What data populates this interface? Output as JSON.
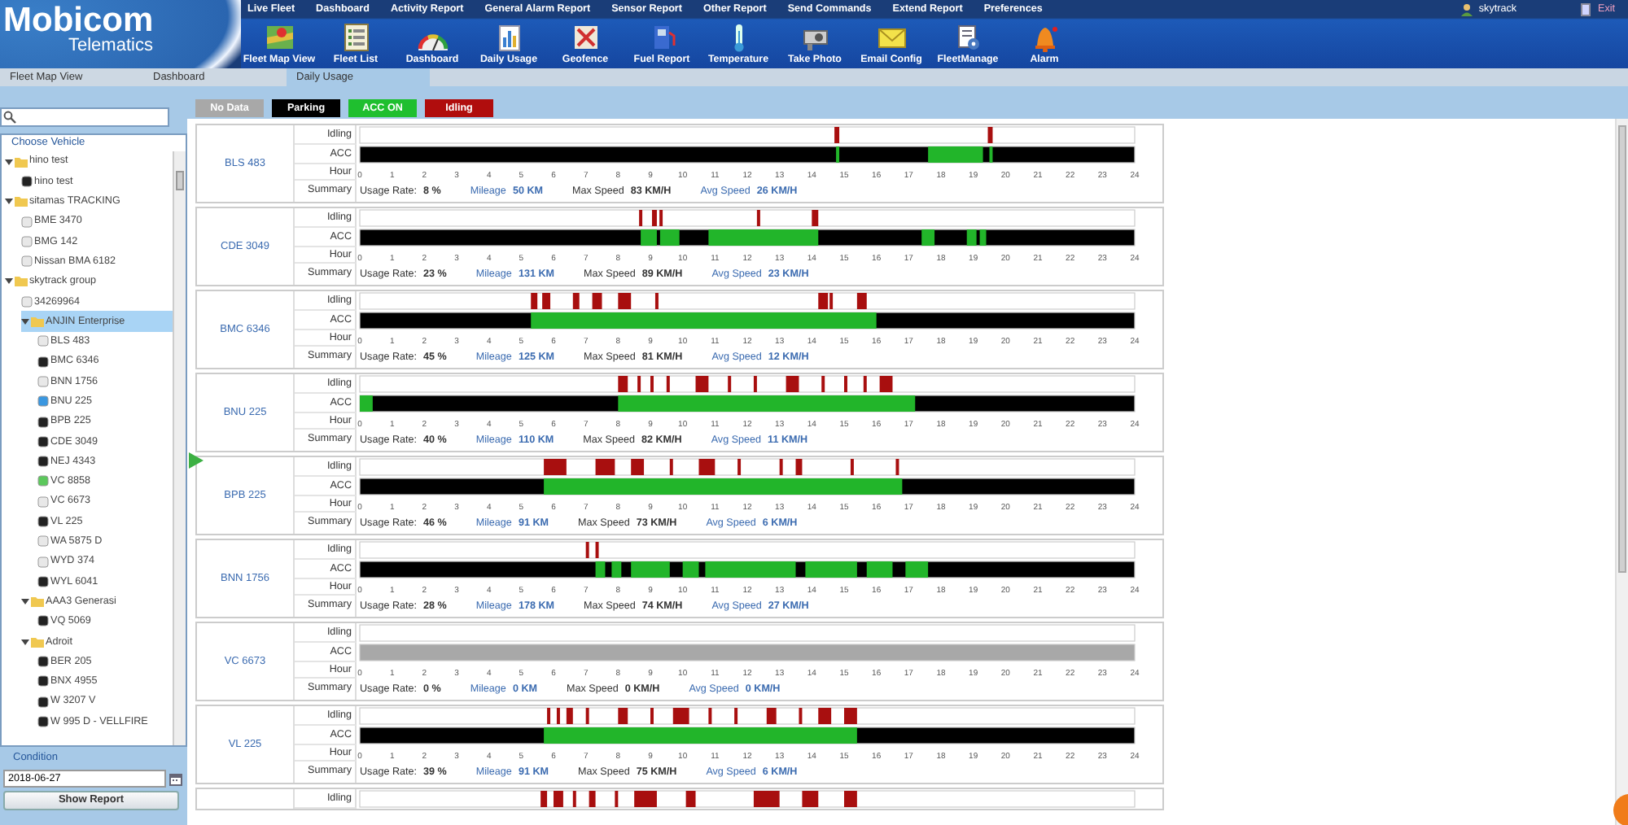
{
  "logo": {
    "name": "Mobicom",
    "subtitle": "Telematics"
  },
  "menu": [
    "Live Fleet",
    "Dashboard",
    "Activity Report",
    "General Alarm Report",
    "Sensor Report",
    "Other Report",
    "Send Commands",
    "Extend Report",
    "Preferences"
  ],
  "user": {
    "name": "skytrack",
    "exit": "Exit"
  },
  "toolbar": [
    {
      "label": "Fleet Map View"
    },
    {
      "label": "Fleet List"
    },
    {
      "label": "Dashboard"
    },
    {
      "label": "Daily Usage"
    },
    {
      "label": "Geofence"
    },
    {
      "label": "Fuel Report"
    },
    {
      "label": "Temperature"
    },
    {
      "label": "Take Photo"
    },
    {
      "label": "Email Config"
    },
    {
      "label": "FleetManage"
    },
    {
      "label": "Alarm"
    }
  ],
  "tabs": [
    {
      "label": "Fleet Map View",
      "selected": false
    },
    {
      "label": "Dashboard",
      "selected": false
    },
    {
      "label": "Daily Usage",
      "selected": true
    }
  ],
  "sidebar": {
    "vehicle_title": "Choose Vehicle",
    "tree": [
      {
        "kind": "folder",
        "label": "hino test",
        "expanded": true,
        "selected": false,
        "children": [
          {
            "kind": "vehicle",
            "label": "hino test",
            "color": "#222222"
          }
        ]
      },
      {
        "kind": "folder",
        "label": "sitamas TRACKING",
        "expanded": true,
        "selected": false,
        "children": [
          {
            "kind": "vehicle",
            "label": "BME 3470",
            "color": "#e8e8e8"
          },
          {
            "kind": "vehicle",
            "label": "BMG 142",
            "color": "#e8e8e8"
          },
          {
            "kind": "vehicle",
            "label": "Nissan BMA 6182",
            "color": "#e8e8e8"
          }
        ]
      },
      {
        "kind": "folder",
        "label": "skytrack group",
        "expanded": true,
        "selected": false,
        "children": [
          {
            "kind": "vehicle",
            "label": "34269964",
            "color": "#e8e8e8"
          },
          {
            "kind": "folder",
            "label": "ANJIN Enterprise",
            "expanded": true,
            "selected": true,
            "children": [
              {
                "kind": "vehicle",
                "label": "BLS 483",
                "color": "#e8e8e8"
              },
              {
                "kind": "vehicle",
                "label": "BMC 6346",
                "color": "#222222"
              },
              {
                "kind": "vehicle",
                "label": "BNN 1756",
                "color": "#e8e8e8"
              },
              {
                "kind": "vehicle",
                "label": "BNU 225",
                "color": "#3a97e0"
              },
              {
                "kind": "vehicle",
                "label": "BPB 225",
                "color": "#222222"
              },
              {
                "kind": "vehicle",
                "label": "CDE 3049",
                "color": "#222222"
              },
              {
                "kind": "vehicle",
                "label": "NEJ 4343",
                "color": "#222222"
              },
              {
                "kind": "vehicle",
                "label": "VC 8858",
                "color": "#5cc85c"
              },
              {
                "kind": "vehicle",
                "label": "VC 6673",
                "color": "#e8e8e8"
              },
              {
                "kind": "vehicle",
                "label": "VL 225",
                "color": "#222222"
              },
              {
                "kind": "vehicle",
                "label": "WA 5875 D",
                "color": "#e8e8e8"
              },
              {
                "kind": "vehicle",
                "label": "WYD 374",
                "color": "#e8e8e8"
              },
              {
                "kind": "vehicle",
                "label": "WYL 6041",
                "color": "#222222"
              }
            ]
          },
          {
            "kind": "folder",
            "label": "AAA3 Generasi",
            "expanded": true,
            "selected": false,
            "children": [
              {
                "kind": "vehicle",
                "label": "VQ 5069",
                "color": "#222222"
              }
            ]
          },
          {
            "kind": "folder",
            "label": "Adroit",
            "expanded": true,
            "selected": false,
            "children": [
              {
                "kind": "vehicle",
                "label": "BER 205",
                "color": "#222222"
              },
              {
                "kind": "vehicle",
                "label": "BNX 4955",
                "color": "#222222"
              },
              {
                "kind": "vehicle",
                "label": "W 3207 V",
                "color": "#222222"
              },
              {
                "kind": "vehicle",
                "label": "W 995 D - VELLFIRE",
                "color": "#222222"
              }
            ]
          }
        ]
      }
    ],
    "condition_title": "Condition",
    "date": "2018-06-27",
    "button": "Show Report"
  },
  "legend": [
    {
      "label": "No Data",
      "color": "#a8a8a8"
    },
    {
      "label": "Parking",
      "color": "#000000"
    },
    {
      "label": "ACC ON",
      "color": "#1fbf2f"
    },
    {
      "label": "Idling",
      "color": "#b00d0d"
    }
  ],
  "rows": [
    {
      "name": "BLS 483",
      "lanes": [
        "Idling",
        "ACC"
      ],
      "hour_label": "Hour",
      "hour_ticks": [
        "0",
        "1",
        "2",
        "3",
        "4",
        "5",
        "6",
        "7",
        "8",
        "9",
        "10",
        "11",
        "12",
        "13",
        "14",
        "15",
        "16",
        "17",
        "18",
        "19",
        "20",
        "21",
        "22",
        "23",
        "24"
      ],
      "summary_label": "Summary",
      "summary": [
        {
          "label": "Usage Rate:",
          "value": "8 %",
          "accent": false
        },
        {
          "label": "Mileage",
          "value": "50 KM",
          "accent": true
        },
        {
          "label": "Max Speed",
          "value": "83 KM/H",
          "accent": false
        },
        {
          "label": "Avg Speed",
          "value": "26 KM/H",
          "accent": true
        }
      ]
    },
    {
      "name": "CDE 3049",
      "lanes": [
        "Idling",
        "ACC"
      ],
      "hour_label": "Hour",
      "hour_ticks": [
        "0",
        "1",
        "2",
        "3",
        "4",
        "5",
        "6",
        "7",
        "8",
        "9",
        "10",
        "11",
        "12",
        "13",
        "14",
        "15",
        "16",
        "17",
        "18",
        "19",
        "20",
        "21",
        "22",
        "23",
        "24"
      ],
      "summary_label": "Summary",
      "summary": [
        {
          "label": "Usage Rate:",
          "value": "23 %",
          "accent": false
        },
        {
          "label": "Mileage",
          "value": "131 KM",
          "accent": true
        },
        {
          "label": "Max Speed",
          "value": "89 KM/H",
          "accent": false
        },
        {
          "label": "Avg Speed",
          "value": "23 KM/H",
          "accent": true
        }
      ]
    },
    {
      "name": "BMC 6346",
      "lanes": [
        "Idling",
        "ACC"
      ],
      "hour_label": "Hour",
      "hour_ticks": [
        "0",
        "1",
        "2",
        "3",
        "4",
        "5",
        "6",
        "7",
        "8",
        "9",
        "10",
        "11",
        "12",
        "13",
        "14",
        "15",
        "16",
        "17",
        "18",
        "19",
        "20",
        "21",
        "22",
        "23",
        "24"
      ],
      "summary_label": "Summary",
      "summary": [
        {
          "label": "Usage Rate:",
          "value": "45 %",
          "accent": false
        },
        {
          "label": "Mileage",
          "value": "125 KM",
          "accent": true
        },
        {
          "label": "Max Speed",
          "value": "81 KM/H",
          "accent": false
        },
        {
          "label": "Avg Speed",
          "value": "12 KM/H",
          "accent": true
        }
      ]
    },
    {
      "name": "BNU 225",
      "lanes": [
        "Idling",
        "ACC"
      ],
      "hour_label": "Hour",
      "hour_ticks": [
        "0",
        "1",
        "2",
        "3",
        "4",
        "5",
        "6",
        "7",
        "8",
        "9",
        "10",
        "11",
        "12",
        "13",
        "14",
        "15",
        "16",
        "17",
        "18",
        "19",
        "20",
        "21",
        "22",
        "23",
        "24"
      ],
      "summary_label": "Summary",
      "summary": [
        {
          "label": "Usage Rate:",
          "value": "40 %",
          "accent": false
        },
        {
          "label": "Mileage",
          "value": "110 KM",
          "accent": true
        },
        {
          "label": "Max Speed",
          "value": "82 KM/H",
          "accent": false
        },
        {
          "label": "Avg Speed",
          "value": "11 KM/H",
          "accent": true
        }
      ]
    },
    {
      "name": "BPB 225",
      "lanes": [
        "Idling",
        "ACC"
      ],
      "hour_label": "Hour",
      "hour_ticks": [
        "0",
        "1",
        "2",
        "3",
        "4",
        "5",
        "6",
        "7",
        "8",
        "9",
        "10",
        "11",
        "12",
        "13",
        "14",
        "15",
        "16",
        "17",
        "18",
        "19",
        "20",
        "21",
        "22",
        "23",
        "24"
      ],
      "summary_label": "Summary",
      "summary": [
        {
          "label": "Usage Rate:",
          "value": "46 %",
          "accent": false
        },
        {
          "label": "Mileage",
          "value": "91 KM",
          "accent": true
        },
        {
          "label": "Max Speed",
          "value": "73 KM/H",
          "accent": false
        },
        {
          "label": "Avg Speed",
          "value": "6 KM/H",
          "accent": true
        }
      ]
    },
    {
      "name": "BNN 1756",
      "lanes": [
        "Idling",
        "ACC"
      ],
      "hour_label": "Hour",
      "hour_ticks": [
        "0",
        "1",
        "2",
        "3",
        "4",
        "5",
        "6",
        "7",
        "8",
        "9",
        "10",
        "11",
        "12",
        "13",
        "14",
        "15",
        "16",
        "17",
        "18",
        "19",
        "20",
        "21",
        "22",
        "23",
        "24"
      ],
      "summary_label": "Summary",
      "summary": [
        {
          "label": "Usage Rate:",
          "value": "28 %",
          "accent": false
        },
        {
          "label": "Mileage",
          "value": "178 KM",
          "accent": true
        },
        {
          "label": "Max Speed",
          "value": "74 KM/H",
          "accent": false
        },
        {
          "label": "Avg Speed",
          "value": "27 KM/H",
          "accent": true
        }
      ]
    },
    {
      "name": "VC 6673",
      "no_data": true,
      "lanes": [
        "Idling",
        "ACC"
      ],
      "hour_label": "Hour",
      "hour_ticks": [
        "0",
        "1",
        "2",
        "3",
        "4",
        "5",
        "6",
        "7",
        "8",
        "9",
        "10",
        "11",
        "12",
        "13",
        "14",
        "15",
        "16",
        "17",
        "18",
        "19",
        "20",
        "21",
        "22",
        "23",
        "24"
      ],
      "summary_label": "Summary",
      "summary": [
        {
          "label": "Usage Rate:",
          "value": "0 %",
          "accent": false
        },
        {
          "label": "Mileage",
          "value": "0 KM",
          "accent": true
        },
        {
          "label": "Max Speed",
          "value": "0 KM/H",
          "accent": false
        },
        {
          "label": "Avg Speed",
          "value": "0 KM/H",
          "accent": true
        }
      ]
    },
    {
      "name": "VL 225",
      "lanes": [
        "Idling",
        "ACC"
      ],
      "hour_label": "Hour",
      "hour_ticks": [
        "0",
        "1",
        "2",
        "3",
        "4",
        "5",
        "6",
        "7",
        "8",
        "9",
        "10",
        "11",
        "12",
        "13",
        "14",
        "15",
        "16",
        "17",
        "18",
        "19",
        "20",
        "21",
        "22",
        "23",
        "24"
      ],
      "summary_label": "Summary",
      "summary": [
        {
          "label": "Usage Rate:",
          "value": "39 %",
          "accent": false
        },
        {
          "label": "Mileage",
          "value": "91 KM",
          "accent": true
        },
        {
          "label": "Max Speed",
          "value": "75 KM/H",
          "accent": false
        },
        {
          "label": "Avg Speed",
          "value": "6 KM/H",
          "accent": true
        }
      ]
    },
    {
      "lanes": [
        "Idling"
      ]
    }
  ]
}
